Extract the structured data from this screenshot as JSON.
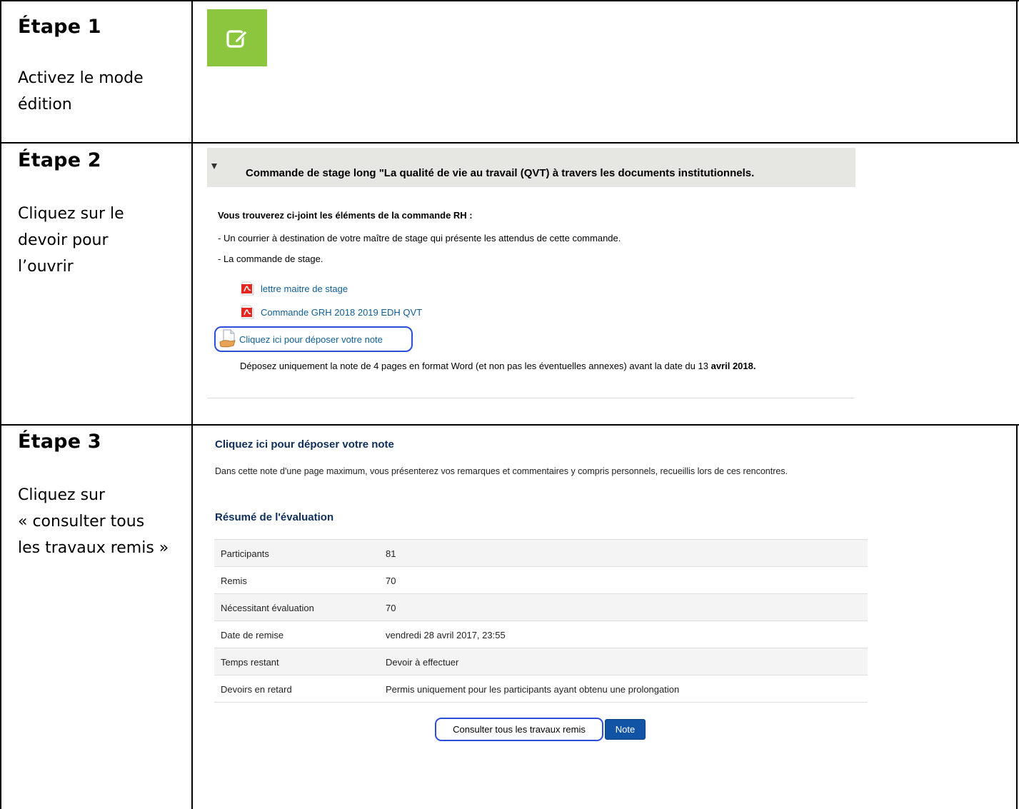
{
  "steps": [
    {
      "title": "Étape 1",
      "desc_lines": [
        "Activez le mode",
        "édition"
      ]
    },
    {
      "title": "Étape 2",
      "desc_lines": [
        "Cliquez sur le",
        "devoir pour",
        "l’ouvrir"
      ]
    },
    {
      "title": "Étape 3",
      "desc_lines": [
        "Cliquez sur",
        "« consulter tous",
        "les travaux remis »"
      ]
    }
  ],
  "step1": {
    "edit_icon": "edit-pencil-icon",
    "accent": "#8cc63f"
  },
  "step2": {
    "section_title": "Commande de stage long \"La qualité de vie au travail (QVT) à travers les documents institutionnels.",
    "intro": "Vous trouverez ci-joint les éléments de la commande RH :",
    "line1": "- Un courrier à destination de votre maître de stage qui présente les attendus de cette commande.",
    "line2": "- La commande de stage.",
    "resources": [
      {
        "label": "lettre maitre de stage",
        "icon": "pdf-icon"
      },
      {
        "label": "Commande GRH 2018 2019 EDH QVT",
        "icon": "pdf-icon"
      }
    ],
    "assignment_link": "Cliquez ici pour déposer votre note",
    "deposit_pre": "Déposez uniquement la note de 4 pages en format Word (et non pas les éventuelles annexes) avant la date du 13",
    "deposit_bold": "avril 2018."
  },
  "step3": {
    "title": "Cliquez ici pour déposer votre note",
    "description": "Dans cette note d'une page maximum, vous présenterez vos remarques et commentaires y compris personnels, recueillis lors de ces rencontres.",
    "summary_title": "Résumé de l'évaluation",
    "rows": [
      {
        "label": "Participants",
        "value": "81"
      },
      {
        "label": "Remis",
        "value": "70"
      },
      {
        "label": "Nécessitant évaluation",
        "value": "70"
      },
      {
        "label": "Date de remise",
        "value": "vendredi 28 avril 2017, 23:55"
      },
      {
        "label": "Temps restant",
        "value": "Devoir à effectuer"
      },
      {
        "label": "Devoirs en retard",
        "value": "Permis uniquement pour les participants ayant obtenu une prolongation"
      }
    ],
    "btn_consult": "Consulter tous les travaux remis",
    "btn_note": "Note",
    "highlight_color": "#2c4edb",
    "primary_color": "#1154a6",
    "heading_color": "#0e2f5c",
    "link_color": "#0f5e96"
  }
}
